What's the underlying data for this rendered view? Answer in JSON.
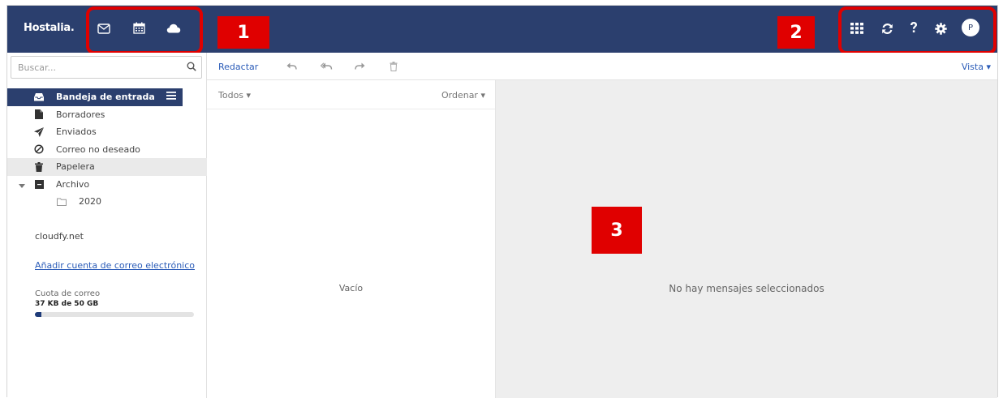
{
  "header": {
    "brand": "Hostalia.",
    "apps": [
      {
        "name": "mail-icon"
      },
      {
        "name": "calendar-icon"
      },
      {
        "name": "cloud-icon"
      }
    ],
    "actions": [
      {
        "name": "apps-grid-icon"
      },
      {
        "name": "refresh-icon"
      },
      {
        "name": "help-icon"
      },
      {
        "name": "settings-icon"
      }
    ],
    "avatar_initial": "P",
    "bar_color": "#2b3f6e"
  },
  "annotations": [
    {
      "label": "1"
    },
    {
      "label": "2"
    },
    {
      "label": "3"
    }
  ],
  "annotation_color": "#e00000",
  "search": {
    "placeholder": "Buscar..."
  },
  "folders": [
    {
      "label": "Bandeja de entrada",
      "icon": "inbox-icon",
      "active": true
    },
    {
      "label": "Borradores",
      "icon": "draft-icon"
    },
    {
      "label": "Enviados",
      "icon": "sent-icon"
    },
    {
      "label": "Correo no deseado",
      "icon": "spam-icon"
    },
    {
      "label": "Papelera",
      "icon": "trash-icon"
    },
    {
      "label": "Archivo",
      "icon": "archive-icon",
      "expanded": true
    },
    {
      "label": "2020",
      "icon": "folder-icon"
    }
  ],
  "account": "cloudfy.net",
  "add_account": "Añadir cuenta de correo electrónico",
  "quota": {
    "label": "Cuota de correo",
    "value": "37 KB de 50 GB",
    "fill_fraction": 0.04
  },
  "toolbar": {
    "compose": "Redactar",
    "icons": [
      "reply-icon",
      "reply-all-icon",
      "forward-icon",
      "delete-icon"
    ],
    "view": "Vista"
  },
  "list": {
    "filter": "Todos",
    "sort": "Ordenar",
    "empty": "Vacío"
  },
  "preview": {
    "empty": "No hay mensajes seleccionados"
  }
}
